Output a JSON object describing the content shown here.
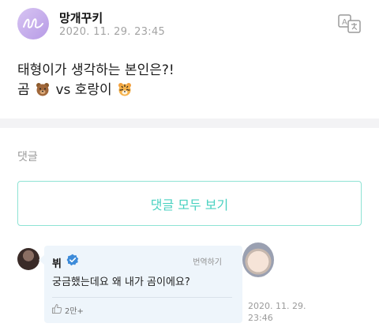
{
  "post": {
    "author": "망개꾸키",
    "timestamp": "2020. 11. 29. 23:45",
    "line1": "태형이가 생각하는 본인은?!",
    "line2_start": "곰",
    "line2_vs": "vs 호랑이"
  },
  "comments_section": {
    "title": "댓글",
    "view_all_label": "댓글 모두 보기"
  },
  "comment": {
    "author": "뷔",
    "translate_label": "번역하기",
    "text": "궁금했는데요 왜 내가 곰이에요?",
    "likes": "2만+",
    "timestamp": "2020. 11. 29. 23:46"
  },
  "icons": {
    "translate": "translate-icon",
    "bear_emoji": "bear-emoji-icon",
    "tiger_emoji": "tiger-emoji-icon",
    "verified": "verified-badge-icon",
    "like": "thumbs-up-icon"
  },
  "colors": {
    "accent": "#48d1c0",
    "bubble": "#eef5fb",
    "verified": "#3d8bd9"
  }
}
